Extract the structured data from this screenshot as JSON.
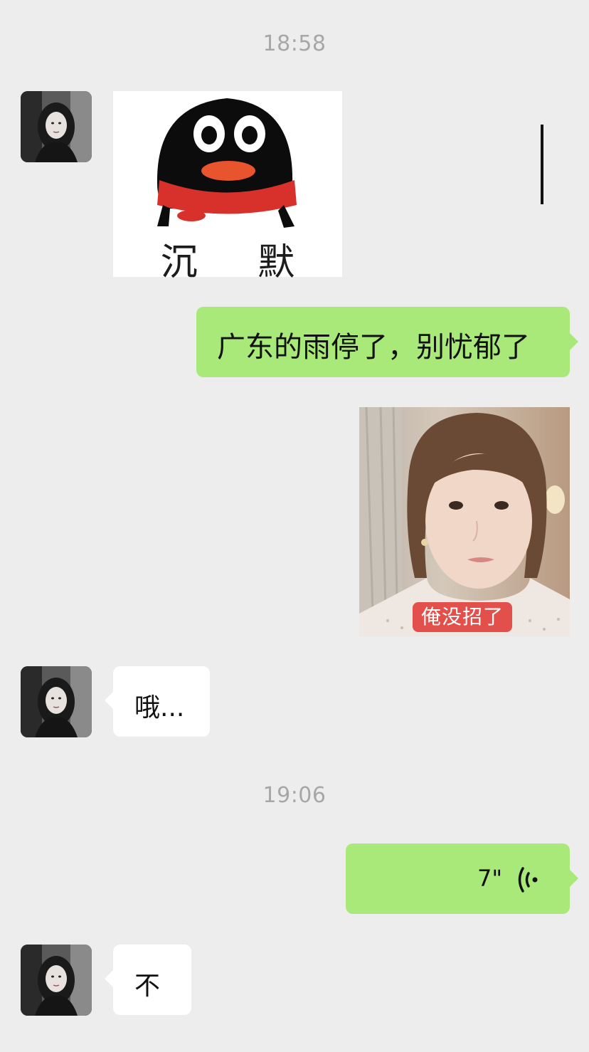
{
  "timestamps": [
    "18:58",
    "19:06"
  ],
  "messages": {
    "m1_sticker_caption": "沉 默",
    "m2_text": "广东的雨停了，别忧郁了",
    "m3_photo_caption": "俺没招了",
    "m4_text": "哦...",
    "m5_voice_duration": "7\"",
    "m6_text": "不"
  },
  "icons": {
    "avatar": "avatar-image",
    "voice": "voice-wave-icon"
  },
  "colors": {
    "background": "#ededed",
    "bubble_self": "#a9e979",
    "bubble_other": "#ffffff",
    "timestamp": "#a7a7a7",
    "photo_caption_bg": "#e3504b"
  }
}
